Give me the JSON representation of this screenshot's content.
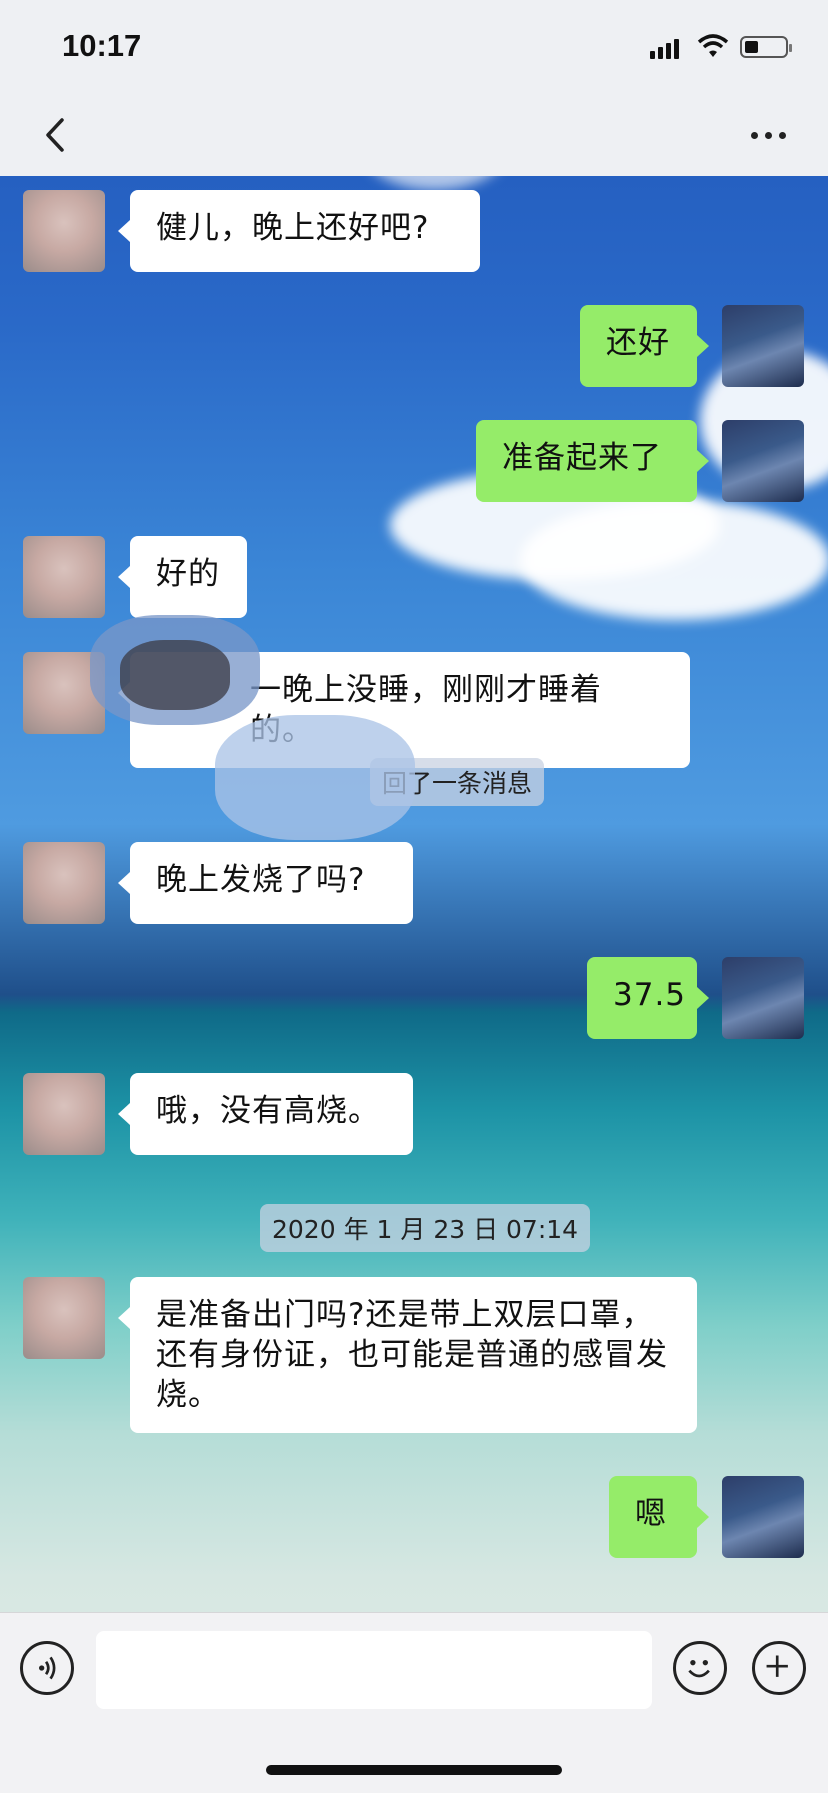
{
  "status_bar": {
    "time": "10:17"
  },
  "chat": {
    "messages": [
      {
        "side": "left",
        "text": "健儿，晚上还好吧?"
      },
      {
        "side": "right",
        "text": "还好"
      },
      {
        "side": "right",
        "text": "准备起来了"
      },
      {
        "side": "left",
        "text": "好的"
      },
      {
        "side": "left",
        "text": "一晚上没睡，刚刚才睡着的。"
      },
      {
        "side": "left",
        "text": "晚上发烧了吗?"
      },
      {
        "side": "right",
        "text": "37.5"
      },
      {
        "side": "left",
        "text": "哦，没有高烧。"
      },
      {
        "side": "left",
        "text": "是准备出门吗?还是带上双层口罩，还有身份证，也可能是普通的感冒发烧。"
      },
      {
        "side": "right",
        "text": "嗯"
      }
    ],
    "recall_notice": "回了一条消息",
    "timestamp": "2020 年 1 月 23 日 07:14"
  },
  "colors": {
    "bubble_self": "#95ec69",
    "bubble_other": "#ffffff",
    "bar_bg": "#eef0f3"
  },
  "icons": {
    "back": "chevron-left-icon",
    "more": "ellipsis-icon",
    "voice": "voice-icon",
    "emoji": "emoji-icon",
    "plus": "plus-icon"
  }
}
